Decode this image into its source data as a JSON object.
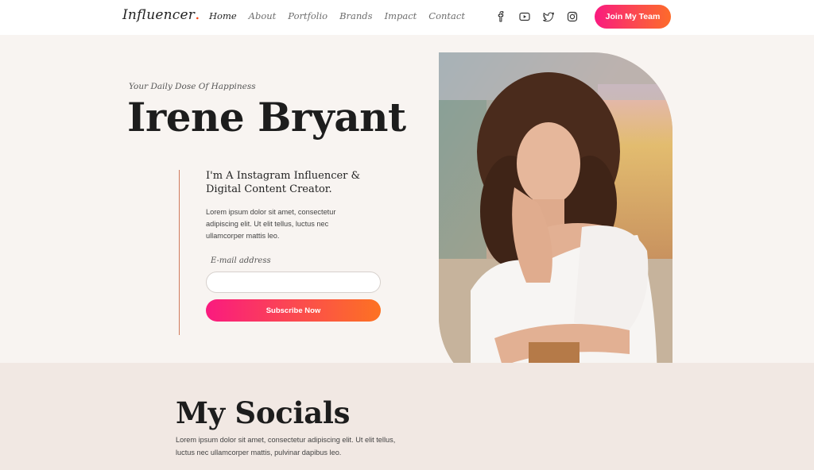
{
  "header": {
    "logo": "Influencer",
    "logo_dot": ".",
    "nav": [
      {
        "label": "Home",
        "active": true
      },
      {
        "label": "About",
        "active": false
      },
      {
        "label": "Portfolio",
        "active": false
      },
      {
        "label": "Brands",
        "active": false
      },
      {
        "label": "Impact",
        "active": false
      },
      {
        "label": "Contact",
        "active": false
      }
    ],
    "social_icons": [
      "facebook-icon",
      "youtube-icon",
      "twitter-icon",
      "instagram-icon"
    ],
    "cta_label": "Join My Team"
  },
  "hero": {
    "tagline": "Your Daily Dose Of Happiness",
    "name": "Irene Bryant",
    "intro": "I'm A Instagram Influencer & Digital Content Creator.",
    "description": "Lorem ipsum dolor sit amet, consectetur adipiscing elit. Ut elit tellus, luctus nec ullamcorper mattis leo.",
    "email_label": "E-mail address",
    "email_value": "",
    "subscribe_label": "Subscribe Now"
  },
  "socials_section": {
    "title": "My Socials",
    "description": "Lorem ipsum dolor sit amet, consectetur adipiscing elit. Ut elit tellus, luctus nec ullamcorper mattis, pulvinar dapibus leo."
  },
  "colors": {
    "accent_start": "#fa1a7f",
    "accent_end": "#fd6b2a",
    "hero_bg": "#f8f4f1",
    "section_bg": "#f1e8e3",
    "divider": "#d07a5c"
  }
}
